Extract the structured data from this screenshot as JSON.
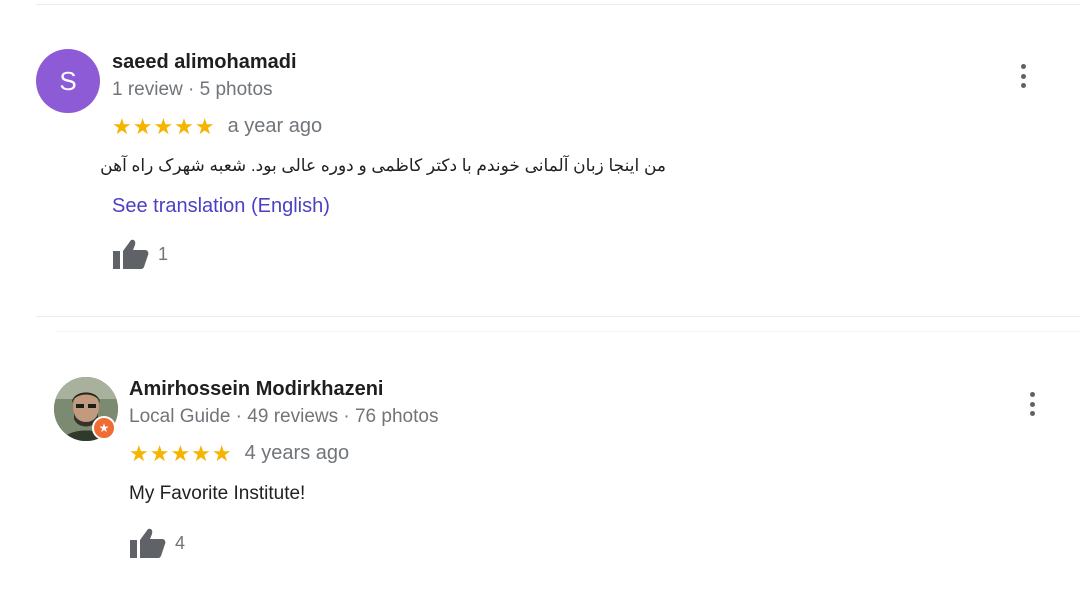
{
  "reviews": [
    {
      "avatar_letter": "S",
      "name": "saeed alimohamadi",
      "meta": "1 review · 5 photos",
      "stars": "★★★★★",
      "rating": 5,
      "time": "a year ago",
      "text": "من اینجا زبان آلمانی خوندم با دکتر کاظمی و دوره عالی بود. شعبه شهرک راه آهن",
      "translate_link": "See translation (English)",
      "likes": "1"
    },
    {
      "name": "Amirhossein Modirkhazeni",
      "meta": "Local Guide · 49 reviews · 76 photos",
      "stars": "★★★★★",
      "rating": 5,
      "time": "4 years ago",
      "text": "My Favorite Institute!",
      "likes": "4"
    }
  ],
  "icons": {
    "thumb": "thumbs-up-icon",
    "menu": "more-vert-icon",
    "badge": "local-guide-badge-icon"
  },
  "colors": {
    "star": "#f5b400",
    "link": "#4c3fc4",
    "avatar_letter_bg": "#8e5bd6",
    "badge": "#ef6c33"
  }
}
